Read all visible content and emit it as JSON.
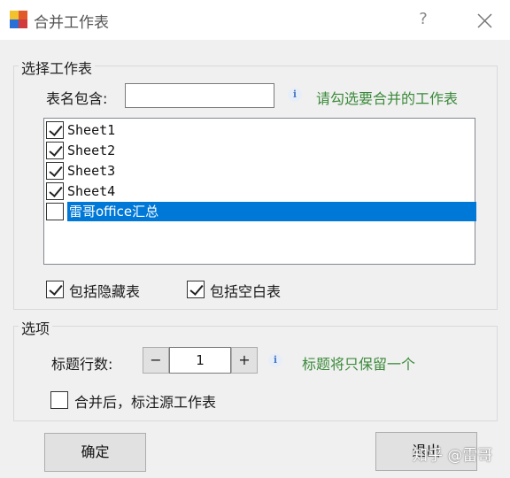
{
  "window": {
    "title": "合并工作表",
    "help_glyph": "?"
  },
  "select_group": {
    "legend": "选择工作表",
    "name_contains_label": "表名包含:",
    "name_contains_value": "",
    "hint": "请勾选要合并的工作表",
    "items": [
      {
        "label": "Sheet1",
        "checked": true,
        "selected": false
      },
      {
        "label": "Sheet2",
        "checked": true,
        "selected": false
      },
      {
        "label": "Sheet3",
        "checked": true,
        "selected": false
      },
      {
        "label": "Sheet4",
        "checked": true,
        "selected": false
      },
      {
        "label": "雷哥office汇总",
        "checked": false,
        "selected": true
      }
    ],
    "include_hidden_label": "包括隐藏表",
    "include_hidden_checked": true,
    "include_blank_label": "包括空白表",
    "include_blank_checked": true
  },
  "options_group": {
    "legend": "选项",
    "header_rows_label": "标题行数:",
    "decrement": "−",
    "header_rows_value": "1",
    "increment": "+",
    "hint": "标题将只保留一个",
    "mark_source_label": "合并后，标注源工作表",
    "mark_source_checked": false
  },
  "buttons": {
    "ok_label": "确定",
    "exit_label": "退出"
  },
  "watermark": "知乎 @雷哥",
  "colors": {
    "accent": "#0078d7",
    "hint_text": "#3b8a3b",
    "background": "#f0f0f0"
  }
}
